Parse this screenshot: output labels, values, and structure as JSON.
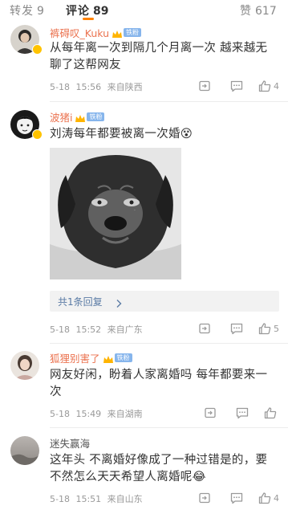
{
  "tabs": [
    {
      "label": "转发",
      "count": "9",
      "active": false
    },
    {
      "label": "评论",
      "count": "89",
      "active": true
    },
    {
      "label": "赞",
      "count": "617",
      "active": false
    }
  ],
  "fan_badge": "铁粉",
  "comments": [
    {
      "username": "裤碍叹_Kuku",
      "text": "从每年离一次到隔几个月离一次  越来越无聊了这帮网友",
      "date": "5-18",
      "time": "15:56",
      "location": "来自陕西",
      "likes": "4"
    },
    {
      "username": "波猪i",
      "text": "刘涛每年都要被离一次婚😵",
      "date": "5-18",
      "time": "15:52",
      "location": "来自广东",
      "likes": "5",
      "image_alt": "dog-meme-image",
      "replies_label": "共1条回复"
    },
    {
      "username": "狐狸别害了",
      "text": "网友好闲，盼着人家离婚吗  每年都要来一次",
      "date": "5-18",
      "time": "15:49",
      "location": "来自湖南",
      "likes": ""
    },
    {
      "username": "迷失赢海",
      "text": "这年头  不离婚好像成了一种过错是的，要不然怎么天天希望人离婚呢😂",
      "date": "5-18",
      "time": "15:51",
      "location": "来自山东",
      "likes": "4"
    }
  ],
  "colors": {
    "accent": "#ff8200",
    "username": "#eb7350",
    "link": "#5a7ba5",
    "fan_badge": "#86b5ec",
    "vip_gold": "#ffc300"
  }
}
